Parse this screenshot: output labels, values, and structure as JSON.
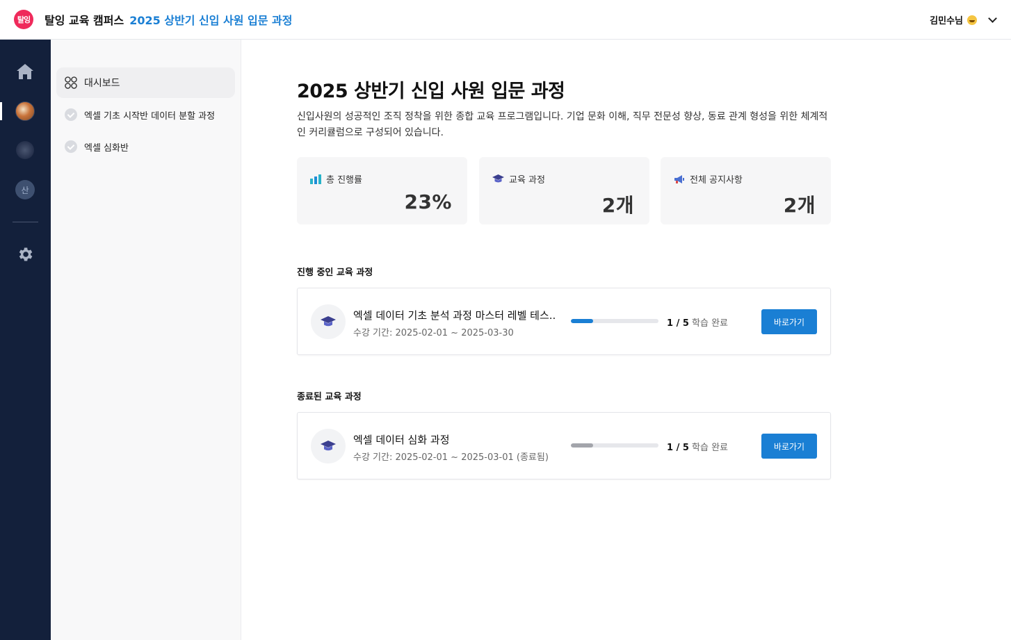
{
  "header": {
    "logo_text": "탈잉",
    "brand": "탈잉 교육 캠퍼스",
    "course_title": "2025 상반기 신입 사원 입문 과정",
    "user_name": "김민수님"
  },
  "sidebar": {
    "items": [
      {
        "label": "대시보드",
        "icon": "grid-icon",
        "active": true
      },
      {
        "label": "엑셀 기초 시작반 데이터 분할 과정",
        "icon": "check-circle-icon"
      },
      {
        "label": "엑셀 심화반",
        "icon": "check-circle-icon"
      }
    ]
  },
  "rail": {
    "avatar_c_text": "산"
  },
  "page": {
    "title": "2025 상반기 신입 사원 입문 과정",
    "description": "신입사원의 성공적인 조직 정착을 위한 종합 교육 프로그램입니다. 기업 문화 이해, 직무 전문성 향상, 동료 관계 형성을 위한 체계적인 커리큘럼으로 구성되어 있습니다."
  },
  "stats": [
    {
      "label": "총 진행률",
      "value": "23%",
      "icon": "bar-chart-icon"
    },
    {
      "label": "교육 과정",
      "value": "2개",
      "icon": "graduation-cap-icon"
    },
    {
      "label": "전체 공지사항",
      "value": "2개",
      "icon": "megaphone-icon"
    }
  ],
  "sections": {
    "ongoing": "진행 중인 교육 과정",
    "finished": "종료된 교육 과정"
  },
  "courses": {
    "ongoing": [
      {
        "name": "엑셀 데이터 기초 분석 과정 마스터 레벨 테스..",
        "period": "수강 기간: 2025-02-01 ~ 2025-03-30",
        "progress_count": "1 / 5",
        "progress_suffix": " 학습 완료",
        "progress_fraction": 0.25,
        "button": "바로가기"
      }
    ],
    "finished": [
      {
        "name": "엑셀 데이터 심화 과정",
        "period": "수강 기간: 2025-02-01 ~ 2025-03-01 (종료됨)",
        "progress_count": "1 / 5",
        "progress_suffix": " 학습 완료",
        "progress_fraction": 0.25,
        "button": "바로가기"
      }
    ]
  },
  "colors": {
    "accent": "#1a7fd4",
    "rail_bg": "#13203b",
    "logo": "#ef2a5b",
    "progress_active": "#1a7fd4",
    "progress_finished": "#a3a5ab"
  }
}
